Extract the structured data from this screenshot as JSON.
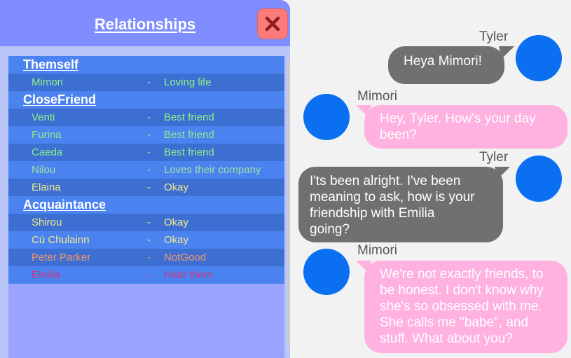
{
  "relationships": {
    "title": "Relationships",
    "close_icon": "close-icon",
    "categories": [
      {
        "label": "Themself"
      },
      {
        "label": "CloseFriend"
      },
      {
        "label": "Acquaintance"
      }
    ],
    "rows": [
      {
        "name": "Mimori",
        "dash": "-",
        "status": "Loving life"
      },
      {
        "name": "Venti",
        "dash": "-",
        "status": "Best friend"
      },
      {
        "name": "Furina",
        "dash": "-",
        "status": "Best friend"
      },
      {
        "name": "Caeda",
        "dash": "-",
        "status": "Best friend"
      },
      {
        "name": "Nilou",
        "dash": "-",
        "status": "Loves their company"
      },
      {
        "name": "Elaina",
        "dash": "-",
        "status": "Okay"
      },
      {
        "name": "Shirou",
        "dash": "-",
        "status": "Okay"
      },
      {
        "name": "Cú Chulainn",
        "dash": "-",
        "status": "Okay"
      },
      {
        "name": "Peter Parker",
        "dash": "-",
        "status": "NotGood"
      },
      {
        "name": "Emilia",
        "dash": "-",
        "status": "Hate them"
      }
    ]
  },
  "chat": {
    "messages": [
      {
        "speaker": "Tyler",
        "lines": [
          "Heya Mimori!"
        ]
      },
      {
        "speaker": "Mimori",
        "lines": [
          "Hey, Tyler. How's your day",
          "been?"
        ]
      },
      {
        "speaker": "Tyler",
        "lines": [
          "I'ts been alright. I've been",
          "meaning to ask, how is your",
          "friendship with Emilia",
          "going?"
        ]
      },
      {
        "speaker": "Mimori",
        "lines": [
          "We're not exactly friends, to",
          "be honest. I don't know why",
          "she's so obsessed with me.",
          "She calls me \"babe\", and",
          "stuff. What about you?"
        ]
      }
    ]
  },
  "colors": {
    "panel": "#8e9bff",
    "close_button": "#ff7b7b",
    "row_dark": "#3c6fd1",
    "row_light": "#4a82f0",
    "avatar": "#0a6ff0",
    "bubble_gray": "#707070",
    "bubble_pink": "#ffb1e0"
  }
}
